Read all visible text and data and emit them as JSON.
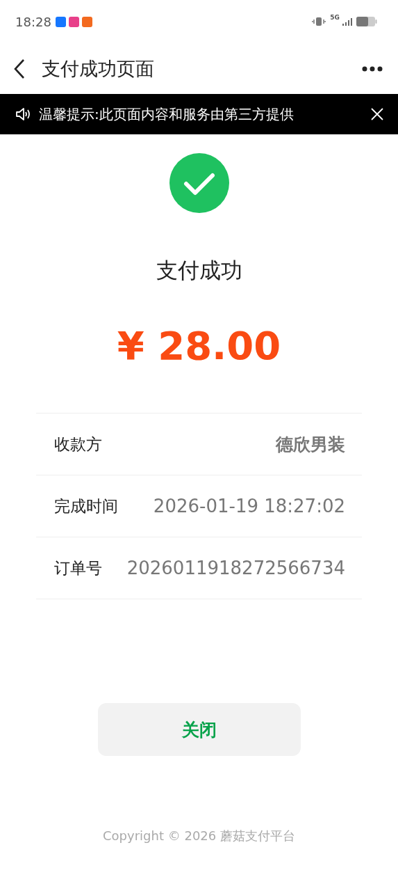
{
  "status_bar": {
    "time": "18:28",
    "network": "5G"
  },
  "nav": {
    "title": "支付成功页面"
  },
  "notice": {
    "text": "温馨提示:此页面内容和服务由第三方提供"
  },
  "result": {
    "title": "支付成功",
    "amount": "¥ 28.00"
  },
  "details": [
    {
      "label": "收款方",
      "value": "德欣男装",
      "emphasized": true
    },
    {
      "label": "完成时间",
      "value": "2026-01-19 18:27:02",
      "emphasized": false
    },
    {
      "label": "订单号",
      "value": "2026011918272566734",
      "emphasized": false
    }
  ],
  "close_button": {
    "label": "关闭"
  },
  "footer": {
    "copyright": "Copyright © 2026 蘑菇支付平台"
  }
}
